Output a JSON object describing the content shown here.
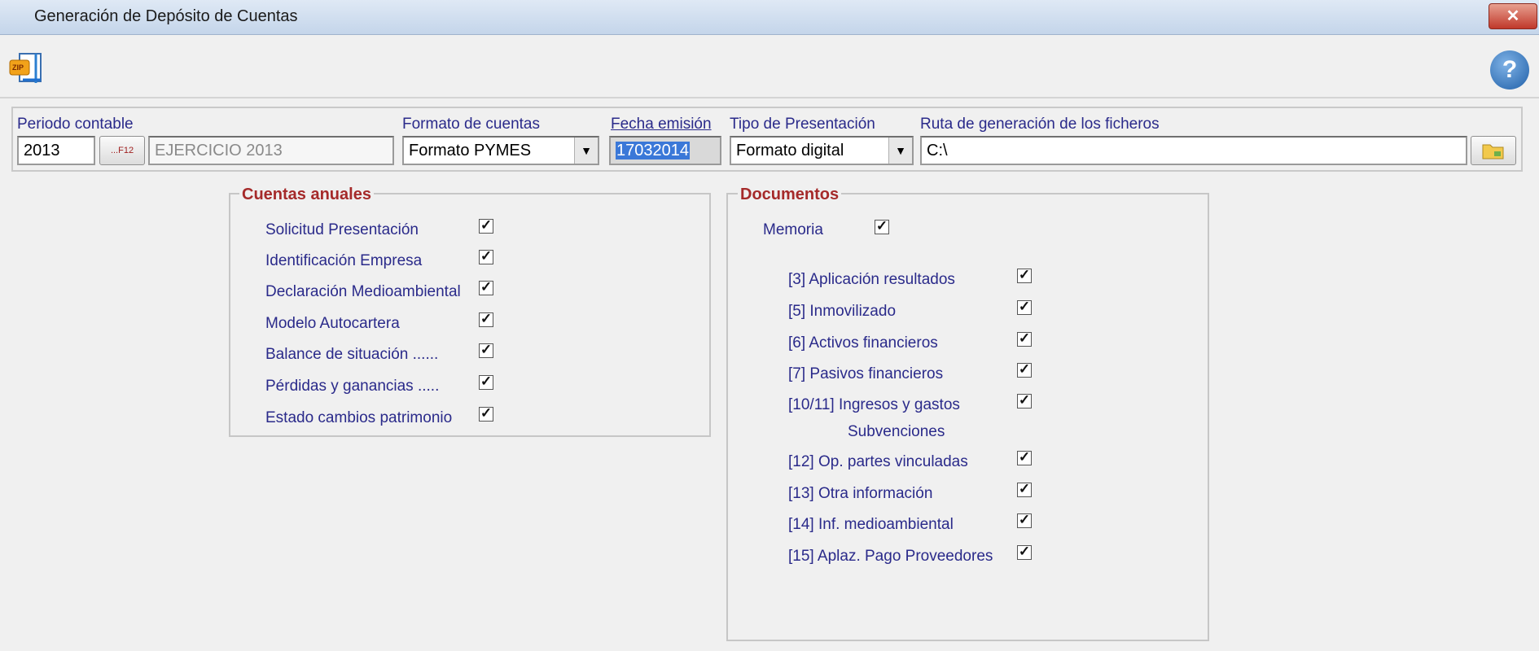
{
  "window": {
    "title": "Generación de Depósito de Cuentas",
    "close": "✕"
  },
  "toolbar": {
    "zip_icon_text": "ZIP",
    "help_glyph": "?"
  },
  "filters": {
    "periodo_label": "Periodo contable",
    "periodo_value": "2013",
    "f12_label": "...F12",
    "ejercicio_value": "EJERCICIO 2013",
    "formato_label": "Formato de cuentas",
    "formato_value": "Formato PYMES",
    "fecha_label": "Fecha emisión",
    "fecha_value": "17032014",
    "tipo_label": "Tipo de Presentación",
    "tipo_value": "Formato digital",
    "ruta_label": "Ruta de generación de los ficheros",
    "ruta_value": "C:\\"
  },
  "cuentas": {
    "legend": "Cuentas anuales",
    "items": [
      {
        "label": "Solicitud Presentación",
        "checked": true
      },
      {
        "label": "Identificación Empresa",
        "checked": true
      },
      {
        "label": "Declaración Medioambiental",
        "checked": true
      },
      {
        "label": "Modelo Autocartera",
        "checked": true
      },
      {
        "label": "Balance de situación ......",
        "checked": true
      },
      {
        "label": "Pérdidas y ganancias .....",
        "checked": true
      },
      {
        "label": "Estado cambios patrimonio",
        "checked": true
      }
    ]
  },
  "documentos": {
    "legend": "Documentos",
    "memoria_label": "Memoria",
    "items": [
      {
        "label": "[3] Aplicación resultados",
        "checked": true
      },
      {
        "label": "[5] Inmovilizado",
        "checked": true
      },
      {
        "label": "[6] Activos financieros",
        "checked": true
      },
      {
        "label": "[7] Pasivos financieros",
        "checked": true
      },
      {
        "label": "[10/11] Ingresos y gastos",
        "checked": true
      },
      {
        "label": "Subvenciones"
      },
      {
        "label": "[12] Op. partes vinculadas",
        "checked": true
      },
      {
        "label": "[13] Otra información",
        "checked": true
      },
      {
        "label": "[14] Inf. medioambiental",
        "checked": true
      },
      {
        "label": "[15] Aplaz. Pago Proveedores",
        "checked": true
      }
    ]
  },
  "check_glyph": "✓"
}
